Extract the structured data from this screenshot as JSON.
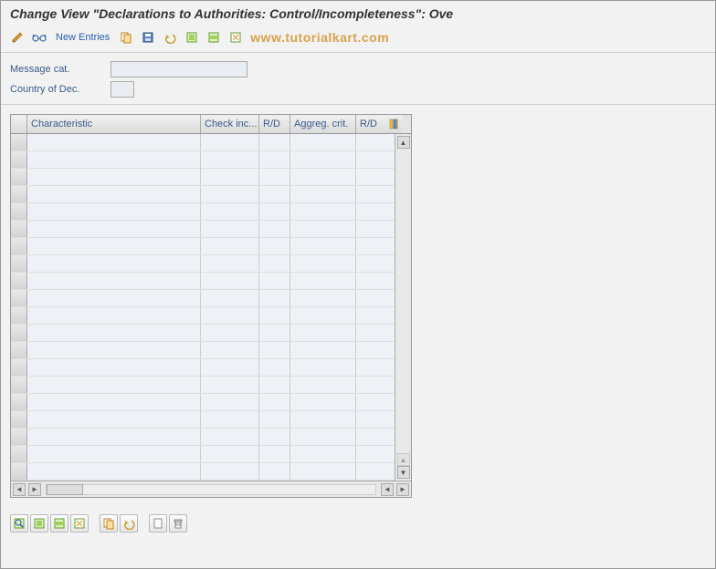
{
  "title": "Change View \"Declarations to Authorities: Control/Incompleteness\": Ove",
  "toolbar": {
    "new_entries": "New Entries",
    "watermark": "www.tutorialkart.com"
  },
  "form": {
    "message_cat_label": "Message cat.",
    "message_cat_value": "",
    "country_label": "Country of Dec.",
    "country_value": ""
  },
  "table": {
    "headers": {
      "characteristic": "Characteristic",
      "check_inc": "Check inc...",
      "rd1": "R/D",
      "aggreg": "Aggreg. crit.",
      "rd2": "R/D"
    },
    "row_count": 20,
    "rows": [
      {
        "characteristic": "",
        "check_inc": "",
        "rd1": "",
        "aggreg": "",
        "rd2": ""
      },
      {
        "characteristic": "",
        "check_inc": "",
        "rd1": "",
        "aggreg": "",
        "rd2": ""
      },
      {
        "characteristic": "",
        "check_inc": "",
        "rd1": "",
        "aggreg": "",
        "rd2": ""
      },
      {
        "characteristic": "",
        "check_inc": "",
        "rd1": "",
        "aggreg": "",
        "rd2": ""
      },
      {
        "characteristic": "",
        "check_inc": "",
        "rd1": "",
        "aggreg": "",
        "rd2": ""
      },
      {
        "characteristic": "",
        "check_inc": "",
        "rd1": "",
        "aggreg": "",
        "rd2": ""
      },
      {
        "characteristic": "",
        "check_inc": "",
        "rd1": "",
        "aggreg": "",
        "rd2": ""
      },
      {
        "characteristic": "",
        "check_inc": "",
        "rd1": "",
        "aggreg": "",
        "rd2": ""
      },
      {
        "characteristic": "",
        "check_inc": "",
        "rd1": "",
        "aggreg": "",
        "rd2": ""
      },
      {
        "characteristic": "",
        "check_inc": "",
        "rd1": "",
        "aggreg": "",
        "rd2": ""
      },
      {
        "characteristic": "",
        "check_inc": "",
        "rd1": "",
        "aggreg": "",
        "rd2": ""
      },
      {
        "characteristic": "",
        "check_inc": "",
        "rd1": "",
        "aggreg": "",
        "rd2": ""
      },
      {
        "characteristic": "",
        "check_inc": "",
        "rd1": "",
        "aggreg": "",
        "rd2": ""
      },
      {
        "characteristic": "",
        "check_inc": "",
        "rd1": "",
        "aggreg": "",
        "rd2": ""
      },
      {
        "characteristic": "",
        "check_inc": "",
        "rd1": "",
        "aggreg": "",
        "rd2": ""
      },
      {
        "characteristic": "",
        "check_inc": "",
        "rd1": "",
        "aggreg": "",
        "rd2": ""
      },
      {
        "characteristic": "",
        "check_inc": "",
        "rd1": "",
        "aggreg": "",
        "rd2": ""
      },
      {
        "characteristic": "",
        "check_inc": "",
        "rd1": "",
        "aggreg": "",
        "rd2": ""
      },
      {
        "characteristic": "",
        "check_inc": "",
        "rd1": "",
        "aggreg": "",
        "rd2": ""
      },
      {
        "characteristic": "",
        "check_inc": "",
        "rd1": "",
        "aggreg": "",
        "rd2": ""
      }
    ]
  }
}
